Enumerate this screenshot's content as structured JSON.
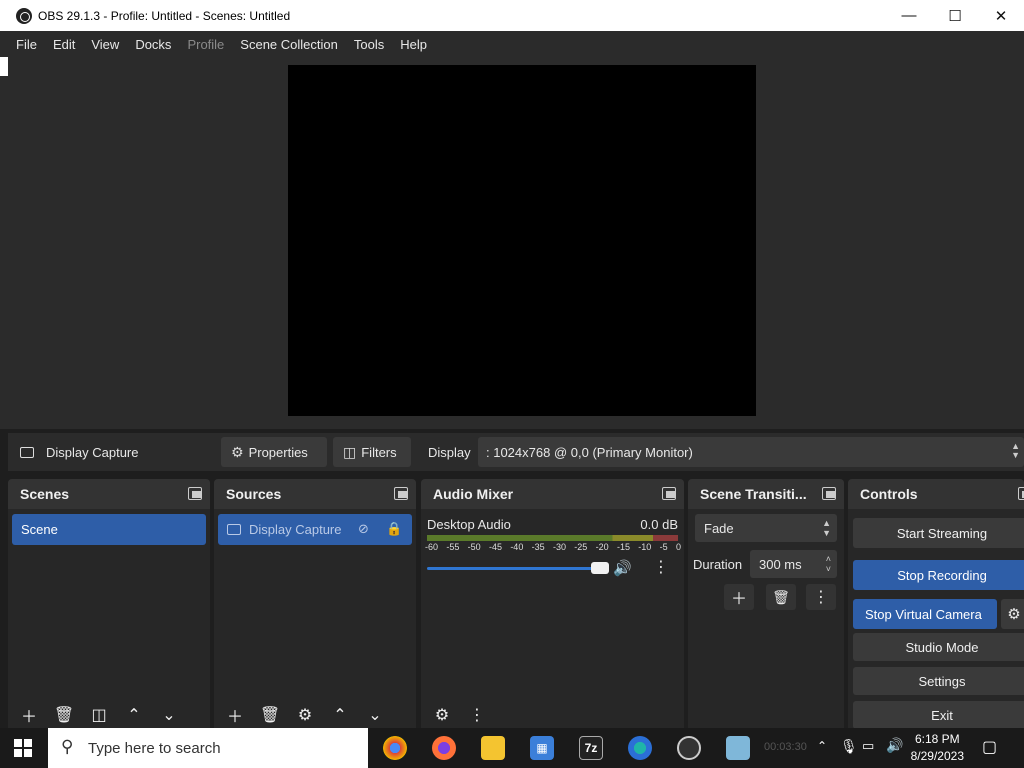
{
  "window": {
    "title": "OBS 29.1.3 - Profile: Untitled - Scenes: Untitled"
  },
  "menu": [
    {
      "label": "File",
      "enabled": true
    },
    {
      "label": "Edit",
      "enabled": true
    },
    {
      "label": "View",
      "enabled": true
    },
    {
      "label": "Docks",
      "enabled": true
    },
    {
      "label": "Profile",
      "enabled": false
    },
    {
      "label": "Scene Collection",
      "enabled": true
    },
    {
      "label": "Tools",
      "enabled": true
    },
    {
      "label": "Help",
      "enabled": true
    }
  ],
  "source_toolbar": {
    "source_name": "Display Capture",
    "properties_label": "Properties",
    "filters_label": "Filters",
    "display_label": "Display",
    "display_value": ": 1024x768 @ 0,0 (Primary Monitor)"
  },
  "docks": {
    "scenes": {
      "title": "Scenes",
      "items": [
        "Scene"
      ]
    },
    "sources": {
      "title": "Sources",
      "items": [
        "Display Capture"
      ]
    },
    "audio_mixer": {
      "title": "Audio Mixer",
      "channel_name": "Desktop Audio",
      "level": "0.0 dB",
      "scale": [
        "-60",
        "-55",
        "-50",
        "-45",
        "-40",
        "-35",
        "-30",
        "-25",
        "-20",
        "-15",
        "-10",
        "-5",
        "0"
      ],
      "volume_fraction": 1.0
    },
    "transitions": {
      "title": "Scene Transiti...",
      "transition": "Fade",
      "duration_label": "Duration",
      "duration_value": "300 ms"
    },
    "controls": {
      "title": "Controls",
      "start_streaming": "Start Streaming",
      "stop_recording": "Stop Recording",
      "stop_virtual_camera": "Stop Virtual Camera",
      "studio_mode": "Studio Mode",
      "settings": "Settings",
      "exit": "Exit"
    }
  },
  "taskbar": {
    "search_placeholder": "Type here to search",
    "time": "6:18 PM",
    "date": "8/29/2023",
    "recording_time": "00:03:30",
    "apps": [
      "chrome-icon",
      "firefox-icon",
      "file-explorer-icon",
      "store-icon",
      "7zip-icon",
      "edge-icon",
      "obs-icon",
      "notepad-icon"
    ]
  },
  "colors": {
    "accent": "#2e5ea8",
    "panel": "#272727",
    "header": "#333333",
    "background": "#1e1e1e"
  }
}
